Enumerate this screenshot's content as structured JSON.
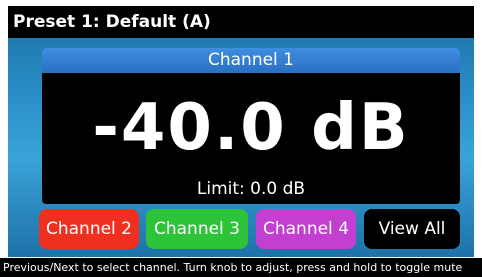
{
  "preset": {
    "title": "Preset 1: Default (A)"
  },
  "channel": {
    "name": "Channel 1",
    "level": "-40.0 dB",
    "limit": "Limit: 0.0 dB"
  },
  "buttons": {
    "channel2": "Channel 2",
    "channel3": "Channel 3",
    "channel4": "Channel 4",
    "view_all": "View All"
  },
  "footer": {
    "hint": "Previous/Next to select channel.  Turn knob to adjust, press and hold to toggle mute"
  },
  "colors": {
    "channel2": "#f0301f",
    "channel3": "#2ec43a",
    "channel4": "#c23fd0",
    "header": "#2a6fc2"
  }
}
